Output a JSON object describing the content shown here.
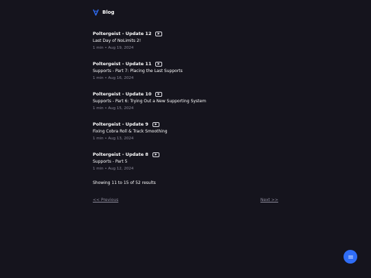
{
  "header": {
    "blog_label": "Blog"
  },
  "posts": [
    {
      "title": "Poltergeist - Update 12",
      "subtitle": "Last Day of NoLimits 2!",
      "meta": "1 min • Aug 19, 2024"
    },
    {
      "title": "Poltergeist - Update 11",
      "subtitle": "Supports - Part 7: Placing the Last Supports",
      "meta": "1 min • Aug 16, 2024"
    },
    {
      "title": "Poltergeist - Update 10",
      "subtitle": "Supports - Part 6: Trying Out a New Supporting System",
      "meta": "1 min • Aug 15, 2024"
    },
    {
      "title": "Poltergeist - Update 9",
      "subtitle": "Fixing Cobra Roll & Track Smoothing",
      "meta": "1 min • Aug 13, 2024"
    },
    {
      "title": "Poltergeist - Update 8",
      "subtitle": "Supports - Part 5",
      "meta": "1 min • Aug 12, 2024"
    }
  ],
  "results_text": "Showing 11 to 15 of 52 results",
  "pagination": {
    "previous_label": "<< Previous",
    "next_label": "Next >>"
  },
  "colors": {
    "background": "#15141d",
    "accent": "#2f6df6",
    "muted": "#8e8c9c"
  },
  "icons": {
    "logo": "logo-icon",
    "video": "play-icon",
    "fab": "menu-icon"
  }
}
